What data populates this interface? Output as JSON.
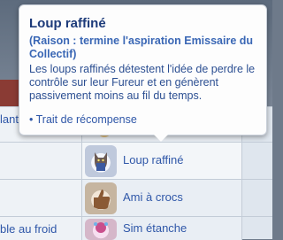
{
  "tooltip": {
    "title": "Loup raffiné",
    "source": "(Raison  : termine l'aspiration Emissaire du Collectif)",
    "description": "Les loups raffinés détestent l'idée de perdre le contrôle sur leur Fureur et en génèrent passivement moins au fil du temps.",
    "bullet": "• Trait de récompense"
  },
  "left_partial_labels": {
    "row0": "lant",
    "row3": "ble au froid"
  },
  "traits": [
    {
      "label": "Loup raffiné",
      "icon": "wolf-icon"
    },
    {
      "label": "Ami à crocs",
      "icon": "thumbs-up-icon"
    },
    {
      "label": "Sim étanche",
      "icon": "sim-icon"
    }
  ]
}
